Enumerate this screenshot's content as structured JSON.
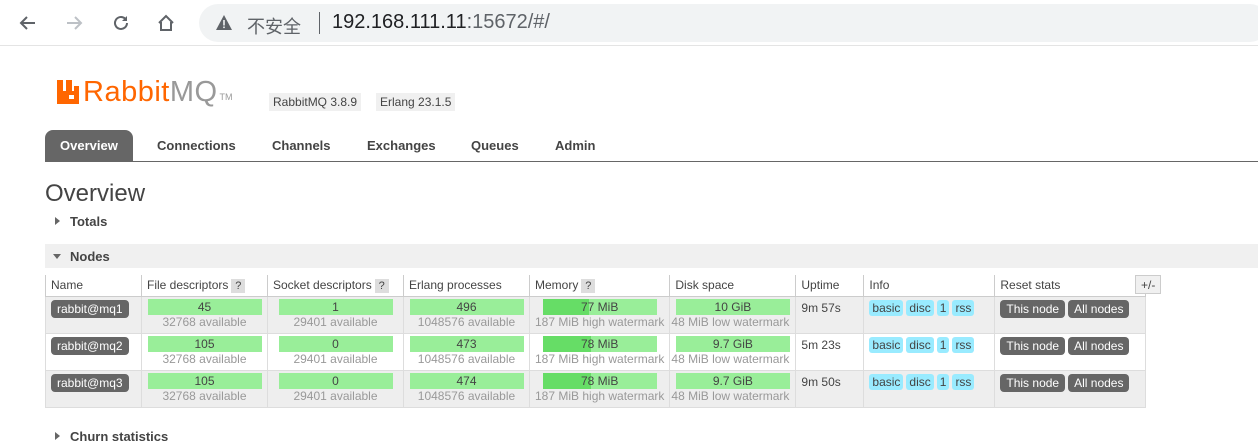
{
  "browser": {
    "insecure_label": "不安全",
    "url_host": "192.168.111.11",
    "url_rest": ":15672/#/"
  },
  "logo": {
    "text_rabbit": "Rabbit",
    "text_mq": "MQ",
    "tm": "TM"
  },
  "versions": {
    "rabbitmq": "RabbitMQ 3.8.9",
    "erlang": "Erlang 23.1.5"
  },
  "tabs": [
    "Overview",
    "Connections",
    "Channels",
    "Exchanges",
    "Queues",
    "Admin"
  ],
  "active_tab": "Overview",
  "page_title": "Overview",
  "sections": {
    "totals": "Totals",
    "nodes": "Nodes",
    "churn": "Churn statistics"
  },
  "table": {
    "headers": [
      "Name",
      "File descriptors",
      "Socket descriptors",
      "Erlang processes",
      "Memory",
      "Disk space",
      "Uptime",
      "Info",
      "Reset stats"
    ],
    "help_label": "?",
    "plus_minus": "+/-",
    "rows": [
      {
        "name": "rabbit@mq1",
        "fd": "45",
        "fd_avail": "32768 available",
        "sock": "1",
        "sock_avail": "29401 available",
        "proc": "496",
        "proc_avail": "1048576 available",
        "mem": "77 MiB",
        "mem_fraction": 0.41,
        "mem_sub": "187 MiB high watermark",
        "disk": "10 GiB",
        "disk_sub": "48 MiB low watermark",
        "uptime": "9m 57s",
        "info": [
          "basic",
          "disc",
          "1",
          "rss"
        ],
        "reset": [
          "This node",
          "All nodes"
        ]
      },
      {
        "name": "rabbit@mq2",
        "fd": "105",
        "fd_avail": "32768 available",
        "sock": "0",
        "sock_avail": "29401 available",
        "proc": "473",
        "proc_avail": "1048576 available",
        "mem": "78 MiB",
        "mem_fraction": 0.42,
        "mem_sub": "187 MiB high watermark",
        "disk": "9.7 GiB",
        "disk_sub": "48 MiB low watermark",
        "uptime": "5m 23s",
        "info": [
          "basic",
          "disc",
          "1",
          "rss"
        ],
        "reset": [
          "This node",
          "All nodes"
        ]
      },
      {
        "name": "rabbit@mq3",
        "fd": "105",
        "fd_avail": "32768 available",
        "sock": "0",
        "sock_avail": "29401 available",
        "proc": "474",
        "proc_avail": "1048576 available",
        "mem": "78 MiB",
        "mem_fraction": 0.42,
        "mem_sub": "187 MiB high watermark",
        "disk": "9.7 GiB",
        "disk_sub": "48 MiB low watermark",
        "uptime": "9m 50s",
        "info": [
          "basic",
          "disc",
          "1",
          "rss"
        ],
        "reset": [
          "This node",
          "All nodes"
        ]
      }
    ]
  },
  "colors": {
    "brand_orange": "#ff6600",
    "bar_green": "#99ee99",
    "mem_fill": "#66dd66",
    "info_tag": "#99ebff",
    "button_gray": "#666666"
  }
}
